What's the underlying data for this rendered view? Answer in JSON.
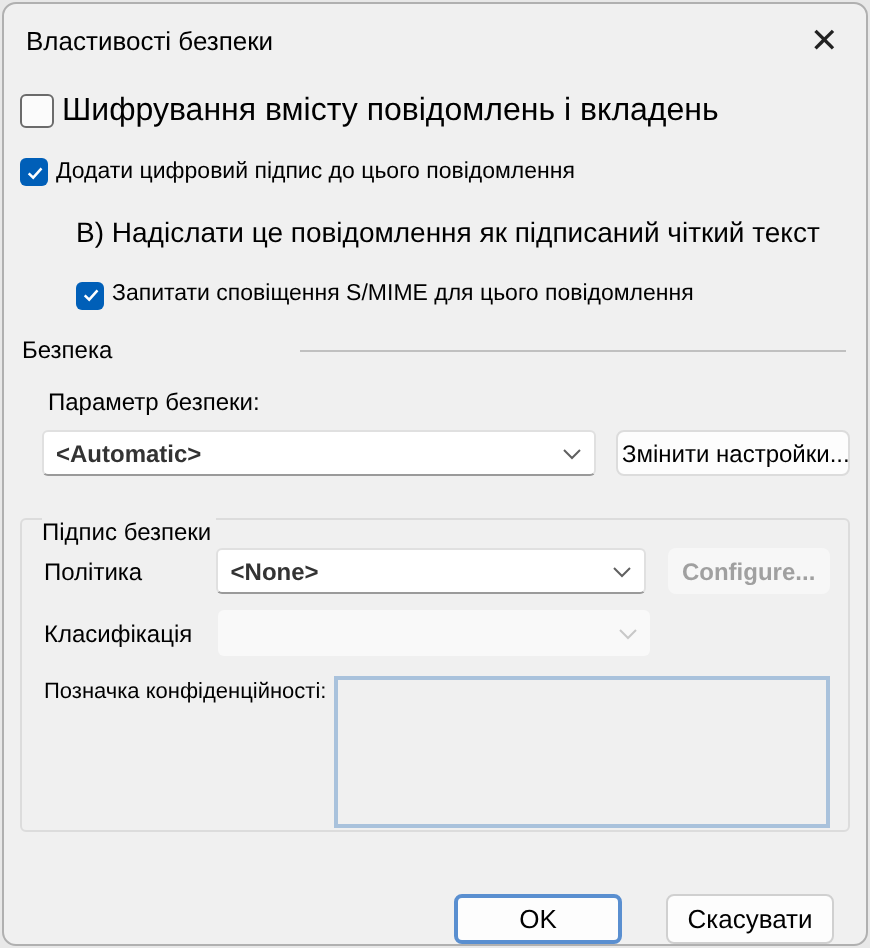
{
  "window": {
    "title": "Властивості безпеки",
    "close": "✕"
  },
  "encrypt": {
    "label": "Шифрування вмісту повідомлень і вкладень",
    "checked": false
  },
  "sign": {
    "label": "Додати цифровий підпис до цього повідомлення",
    "checked": true
  },
  "clear_text": {
    "label": "В) Надіслати це повідомлення як підписаний чіткий текст"
  },
  "receipt": {
    "label": "Запитати сповіщення S/MIME для цього повідомлення",
    "checked": true
  },
  "security": {
    "heading": "Безпека",
    "setting_label": "Параметр безпеки:",
    "setting": {
      "value": "<Automatic>",
      "disabled": false
    },
    "change_button": {
      "label": "Змінити настройки...",
      "disabled": false
    }
  },
  "label_group": {
    "legend": "Підпис безпеки",
    "policy": {
      "label": "Політика",
      "value": "<None>",
      "disabled": false
    },
    "configure_button": {
      "label": "Configure...",
      "disabled": true
    },
    "classification": {
      "label": "Класифікація",
      "disabled": true
    },
    "privacy_label": "Позначка конфіденційності:"
  },
  "buttons": [
    {
      "label": "OK",
      "default": true
    },
    {
      "label": "Скасувати",
      "default": false
    }
  ]
}
